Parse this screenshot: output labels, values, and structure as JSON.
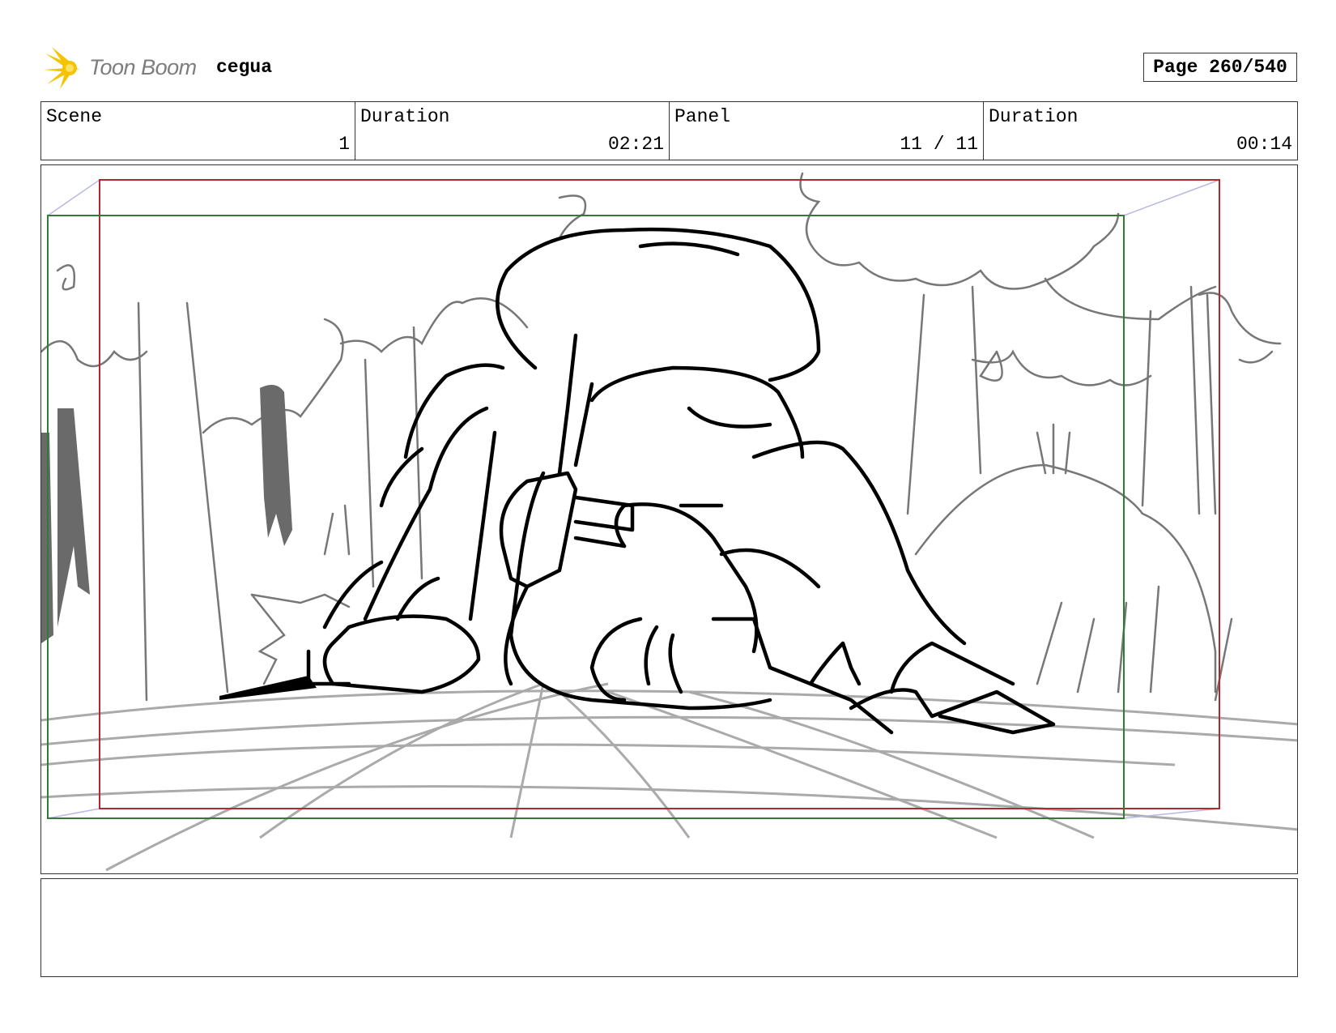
{
  "header": {
    "logo_text": "Toon Boom",
    "project_name": "cegua",
    "page_label": "Page 260/540"
  },
  "info": {
    "scene_label": "Scene",
    "scene_value": "1",
    "scene_duration_label": "Duration",
    "scene_duration_value": "02:21",
    "panel_label": "Panel",
    "panel_value": "11 / 11",
    "panel_duration_label": "Duration",
    "panel_duration_value": "00:14"
  },
  "colors": {
    "safe_frame": "#b3282d",
    "camera_frame": "#2e7d32",
    "perspective": "#b8b8e6",
    "logo_accent": "#f5c400"
  },
  "notes": {
    "text": ""
  }
}
